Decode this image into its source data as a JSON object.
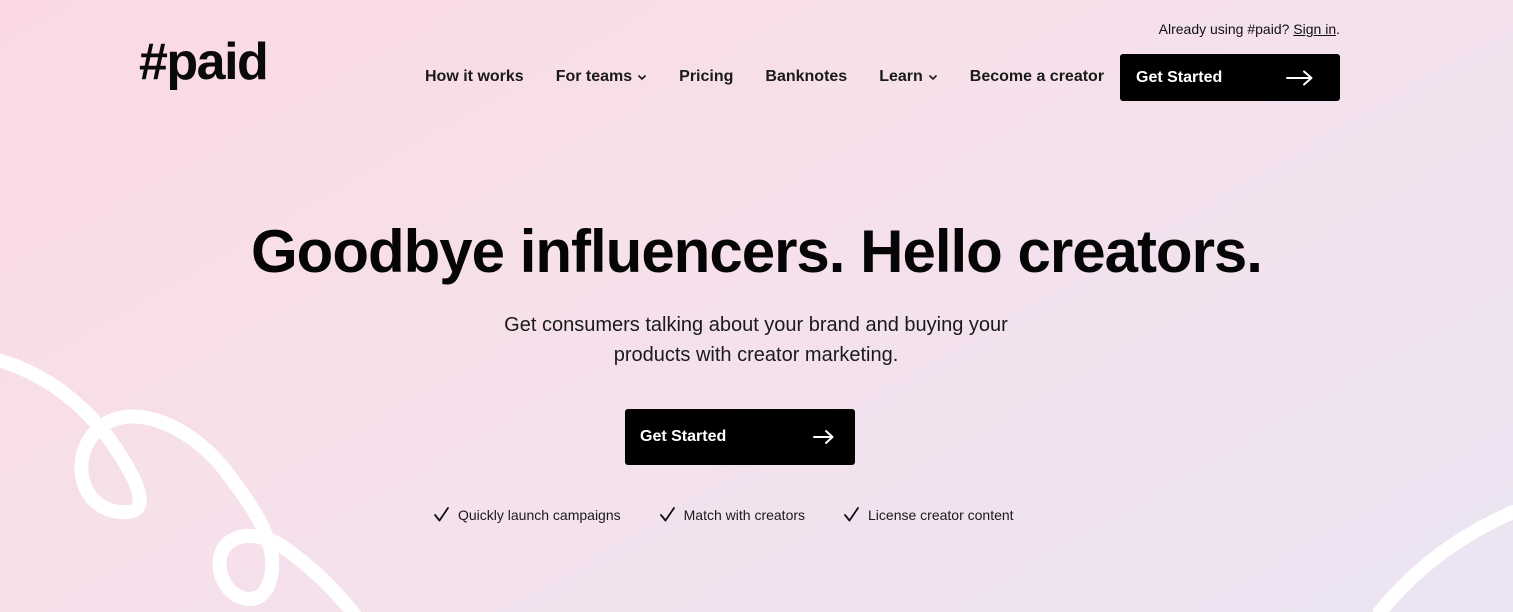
{
  "header": {
    "signin_prefix": "Already using #paid? ",
    "signin_link": "Sign in",
    "signin_suffix": ".",
    "logo": "#paid",
    "nav": [
      {
        "label": "How it works",
        "dropdown": false
      },
      {
        "label": "For teams",
        "dropdown": true
      },
      {
        "label": "Pricing",
        "dropdown": false
      },
      {
        "label": "Banknotes",
        "dropdown": false
      },
      {
        "label": "Learn",
        "dropdown": true
      },
      {
        "label": "Become a creator",
        "dropdown": false
      }
    ],
    "cta_label": "Get Started",
    "cta_icon": "arrow-right-icon"
  },
  "hero": {
    "title": "Goodbye influencers. Hello creators.",
    "subtitle_line1": "Get consumers talking about your brand and buying your",
    "subtitle_line2": "products with creator marketing.",
    "cta_label": "Get Started",
    "cta_icon": "arrow-right-icon",
    "features": [
      {
        "label": "Quickly launch campaigns",
        "icon": "checkmark-icon"
      },
      {
        "label": "Match with creators",
        "icon": "checkmark-icon"
      },
      {
        "label": "License creator content",
        "icon": "checkmark-icon"
      }
    ]
  },
  "colors": {
    "background_start": "#fbd9e3",
    "background_end": "#ebe4f3",
    "button_bg": "#000000",
    "button_text": "#ffffff",
    "decoration_stroke": "#ffffff"
  }
}
